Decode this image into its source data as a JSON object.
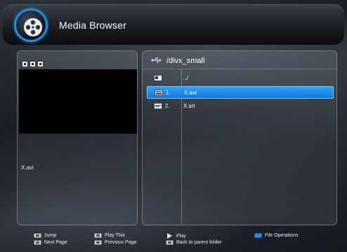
{
  "header": {
    "title": "Media Browser",
    "logo_icon": "film-reel-icon"
  },
  "preview": {
    "filename": "X.avi",
    "view_icons": [
      "view-grid-icon",
      "view-list-icon",
      "view-thumb-icon"
    ]
  },
  "browser": {
    "source_icon": "usb-icon",
    "path": "/divx_small",
    "items": [
      {
        "num": "",
        "name": "../",
        "icon": "folder-up-icon",
        "selected": false
      },
      {
        "num": "1.",
        "name": "X.avi",
        "icon": "video-file-icon",
        "selected": true
      },
      {
        "num": "2.",
        "name": "X.srt",
        "icon": "subtitle-file-icon",
        "selected": false
      }
    ]
  },
  "footer": {
    "jump": "Jump",
    "next_page": "Next Page",
    "play_this": "Play This",
    "previous_page": "Previous Page",
    "play": "Play",
    "back_to_parent": "Back to parent folder",
    "file_operations": "File Operations"
  },
  "colors": {
    "accent": "#1f8ef0",
    "selection": "#1577d6"
  }
}
